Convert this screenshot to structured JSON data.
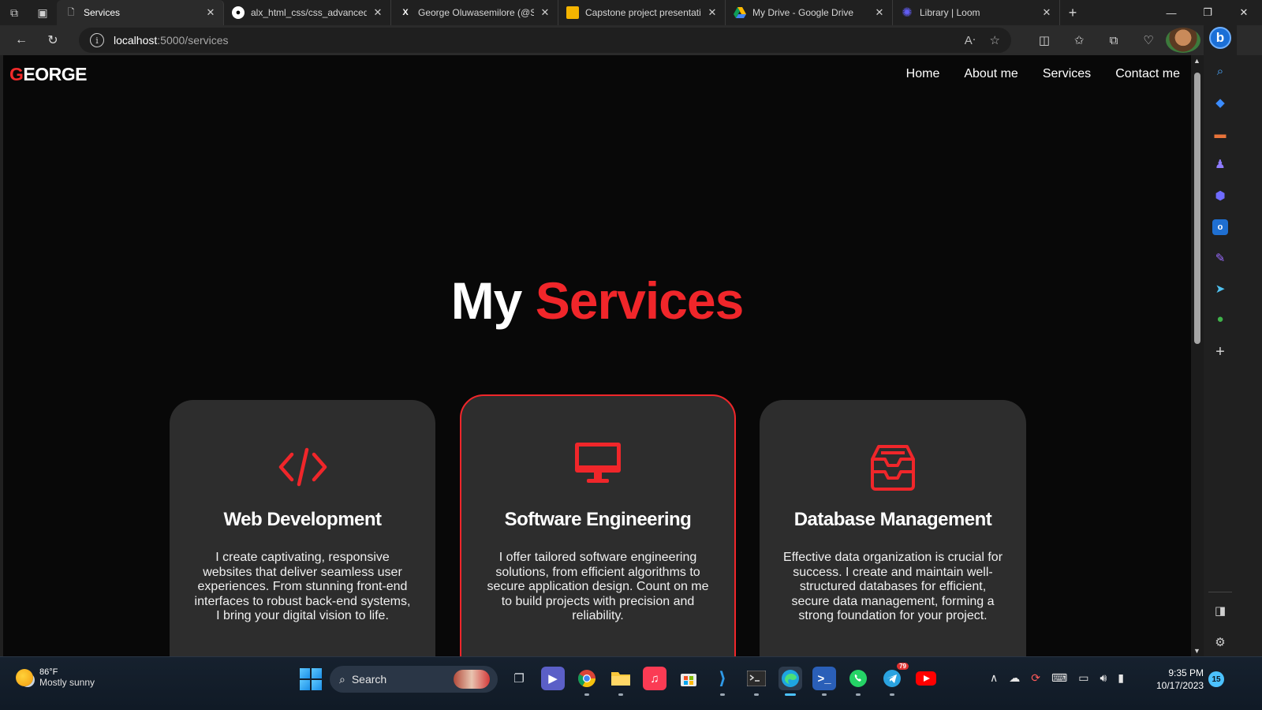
{
  "browser": {
    "tabs": [
      {
        "title": "Services",
        "favicon": "page-icon",
        "active": true
      },
      {
        "title": "alx_html_css/css_advanced a",
        "favicon": "github-icon",
        "active": false
      },
      {
        "title": "George Oluwasemilore (@Se",
        "favicon": "x-icon",
        "active": false
      },
      {
        "title": "Capstone project presentatic",
        "favicon": "slides-icon",
        "active": false
      },
      {
        "title": "My Drive - Google Drive",
        "favicon": "drive-icon",
        "active": false
      },
      {
        "title": "Library | Loom",
        "favicon": "loom-icon",
        "active": false
      }
    ],
    "url_host": "localhost",
    "url_path": ":5000/services"
  },
  "site": {
    "logo_first": "G",
    "logo_rest": "EORGE",
    "nav": [
      "Home",
      "About me",
      "Services",
      "Contact me"
    ],
    "hero_title_white": "My",
    "hero_title_red": "Services",
    "accent_color": "#f0262a",
    "cards": [
      {
        "icon": "code-icon",
        "title": "Web Development",
        "text": "I create captivating, responsive websites that deliver seamless user experiences. From stunning front-end interfaces to robust back-end systems, I bring your digital vision to life.",
        "highlighted": false
      },
      {
        "icon": "desktop-icon",
        "title": "Software Engineering",
        "text": "I offer tailored software engineering solutions, from efficient algorithms to secure application design. Count on me to build projects with precision and reliability.",
        "highlighted": true
      },
      {
        "icon": "inbox-icon",
        "title": "Database Management",
        "text": "Effective data organization is crucial for success. I create and maintain well-structured databases for efficient, secure data management, forming a strong foundation for your project.",
        "highlighted": false
      }
    ]
  },
  "taskbar": {
    "weather_temp": "86°F",
    "weather_desc": "Mostly sunny",
    "search_label": "Search",
    "telegram_badge": "79",
    "time": "9:35 PM",
    "date": "10/17/2023",
    "notification_count": "15"
  }
}
